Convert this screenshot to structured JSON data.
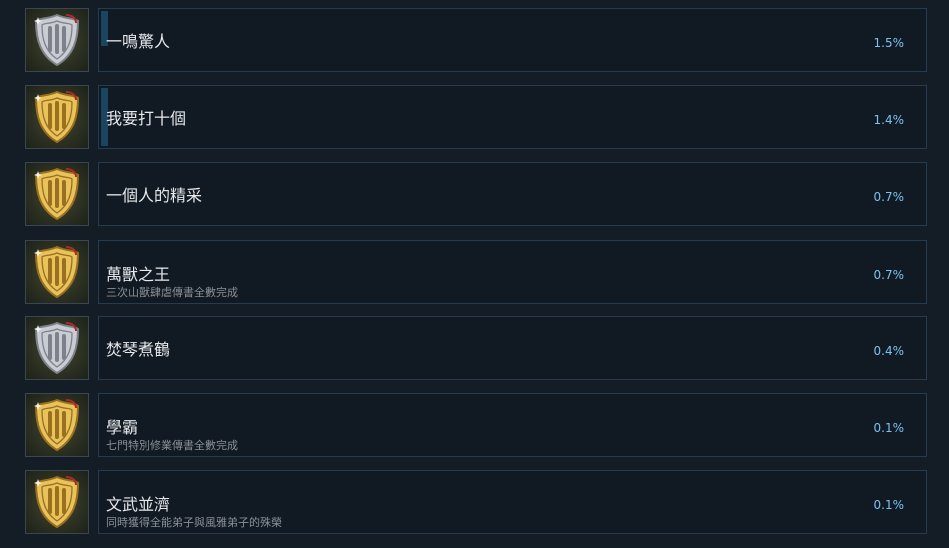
{
  "achievements": [
    {
      "title": "一鳴驚人",
      "description": "",
      "percent": "1.5%",
      "badge": "silver",
      "shows_progress_bar": true,
      "progress_fill": 0.6
    },
    {
      "title": "我要打十個",
      "description": "",
      "percent": "1.4%",
      "badge": "gold",
      "shows_progress_bar": true,
      "progress_fill": 1.0
    },
    {
      "title": "一個人的精采",
      "description": "",
      "percent": "0.7%",
      "badge": "gold",
      "shows_progress_bar": false
    },
    {
      "title": "萬獸之王",
      "description": "三次山獸肆虐傳書全數完成",
      "percent": "0.7%",
      "badge": "gold",
      "shows_progress_bar": false
    },
    {
      "title": "焚琴煮鶴",
      "description": "",
      "percent": "0.4%",
      "badge": "silver",
      "shows_progress_bar": false
    },
    {
      "title": "學霸",
      "description": "七門特別修業傳書全數完成",
      "percent": "0.1%",
      "badge": "gold",
      "shows_progress_bar": false
    },
    {
      "title": "文武並濟",
      "description": "同時獲得全能弟子與風雅弟子的殊榮",
      "percent": "0.1%",
      "badge": "gold",
      "shows_progress_bar": false
    }
  ],
  "colors": {
    "background": "#141c26",
    "card_border": "#233c51",
    "title": "#e6e8ea",
    "description": "#8a9097",
    "percent": "#7ac3f0",
    "progress": "#1a4560",
    "gold_badge": "#e8c25a",
    "silver_badge": "#c9ccd2"
  },
  "icons": {
    "gold": "gold-shield-emblem-icon",
    "silver": "silver-shield-emblem-icon"
  }
}
